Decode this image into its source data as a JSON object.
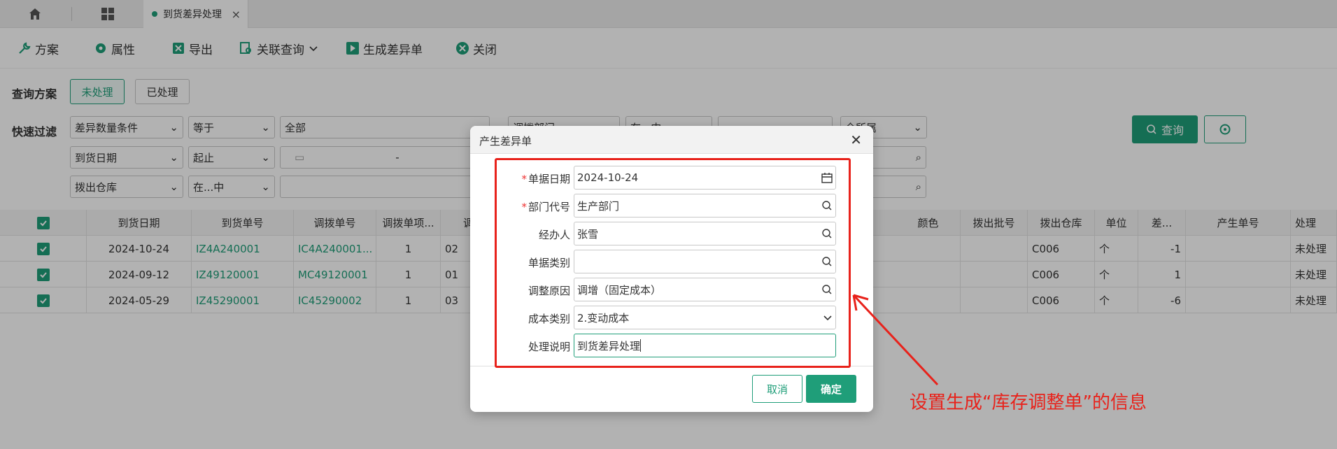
{
  "topbar": {
    "tab_label": "到货差异处理",
    "icons": [
      "home-icon",
      "grid-icon",
      "close-icon"
    ]
  },
  "toolbar": {
    "scheme": "方案",
    "property": "属性",
    "export": "导出",
    "related_query": "关联查询",
    "generate": "生成差异单",
    "close": "关闭"
  },
  "query": {
    "scheme_label": "查询方案",
    "unprocessed": "未处理",
    "processed": "已处理",
    "filter_label": "快速过滤",
    "row1": [
      "差异数量条件",
      "等于",
      "全部",
      "调拨部门",
      "在...中",
      "",
      "全所属"
    ],
    "row2": [
      "到货日期",
      "起止",
      "-"
    ],
    "row3": [
      "拨出仓库",
      "在...中"
    ],
    "query_btn": "查询"
  },
  "grid": {
    "headers": [
      "到货日期",
      "到货单号",
      "调拨单号",
      "调拨单项...",
      "调",
      "颜色",
      "拨出批号",
      "拨出仓库",
      "单位",
      "差...",
      "产生单号",
      "处理"
    ],
    "rows": [
      {
        "date": "2024-10-24",
        "arr_no": "IZ4A240001",
        "trans_no": "IC4A240001...",
        "item": "1",
        "c5": "02",
        "wh": "C006",
        "unit": "个",
        "diff": "-1",
        "status": "未处理"
      },
      {
        "date": "2024-09-12",
        "arr_no": "IZ49120001",
        "trans_no": "MC49120001",
        "item": "1",
        "c5": "01",
        "wh": "C006",
        "unit": "个",
        "diff": "1",
        "status": "未处理"
      },
      {
        "date": "2024-05-29",
        "arr_no": "IZ45290001",
        "trans_no": "IC45290002",
        "item": "1",
        "c5": "03",
        "wh": "C006",
        "unit": "个",
        "diff": "-6",
        "status": "未处理"
      }
    ]
  },
  "dialog": {
    "title": "产生差异单",
    "fields": [
      {
        "label": "单据日期",
        "value": "2024-10-24",
        "required": true,
        "icon": "calendar-icon"
      },
      {
        "label": "部门代号",
        "value": "生产部门",
        "required": true,
        "icon": "search-icon"
      },
      {
        "label": "经办人",
        "value": "张雪",
        "required": false,
        "icon": "search-icon"
      },
      {
        "label": "单据类别",
        "value": "",
        "required": false,
        "icon": "search-icon"
      },
      {
        "label": "调整原因",
        "value": "调增（固定成本）",
        "required": false,
        "icon": "search-icon"
      },
      {
        "label": "成本类别",
        "value": "2.变动成本",
        "required": false,
        "icon": "chevron-down-icon"
      },
      {
        "label": "处理说明",
        "value": "到货差异处理",
        "required": false,
        "icon": ""
      }
    ],
    "cancel": "取消",
    "ok": "确定"
  },
  "annotation": "设置生成“库存调整单”的信息",
  "colors": {
    "accent": "#1f9e79",
    "annotation": "#e8221b"
  }
}
